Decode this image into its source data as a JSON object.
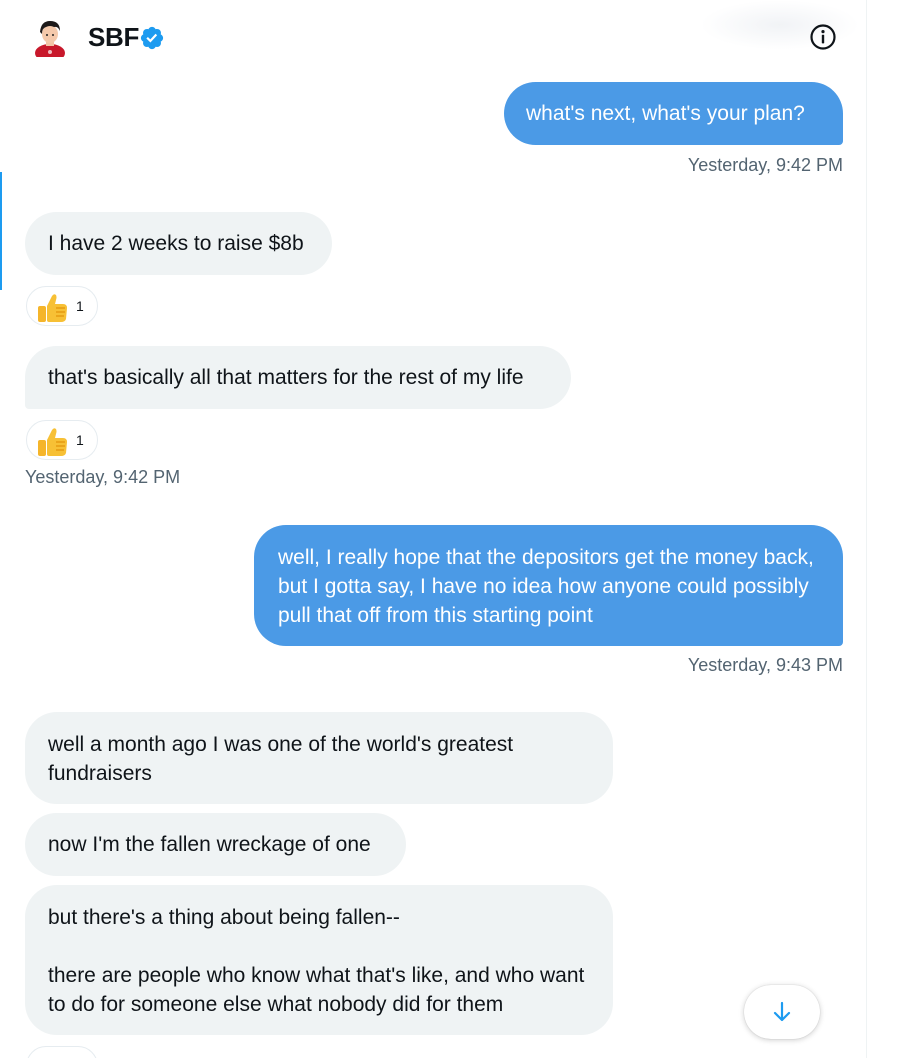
{
  "header": {
    "name": "SBF",
    "verified_icon": "verified-badge-icon",
    "info_icon": "info-icon",
    "brand_color": "#1d9bf0"
  },
  "messages": [
    {
      "direction": "outgoing",
      "text": "what's next, what's your plan?"
    },
    {
      "direction": "outgoing_time",
      "text": "Yesterday, 9:42 PM"
    },
    {
      "direction": "incoming",
      "text": "I have 2 weeks to raise $8b",
      "reaction": {
        "emoji": "thumbs-up-icon",
        "count": "1"
      }
    },
    {
      "direction": "incoming",
      "text": "that's basically all that matters for the rest of my life",
      "reaction": {
        "emoji": "thumbs-up-icon",
        "count": "1"
      }
    },
    {
      "direction": "incoming_time",
      "text": "Yesterday, 9:42 PM"
    },
    {
      "direction": "outgoing",
      "text": "well, I really hope that the depositors get the money back, but I gotta say, I have no idea how anyone could possibly pull that off from this starting point"
    },
    {
      "direction": "outgoing_time",
      "text": "Yesterday, 9:43 PM"
    },
    {
      "direction": "incoming",
      "text": "well a month ago I was one of the world's greatest fundraisers"
    },
    {
      "direction": "incoming",
      "text": "now I'm the fallen wreckage of one"
    },
    {
      "direction": "incoming",
      "text": "but there's a thing about being fallen--\n\nthere are people who know what that's like, and who want to do for someone else what nobody did for them"
    }
  ],
  "colors": {
    "outgoing_bubble": "#4b9ae6",
    "incoming_bubble": "#eff3f4",
    "timestamp": "#536471"
  },
  "scroll_button_icon": "arrow-down-icon"
}
